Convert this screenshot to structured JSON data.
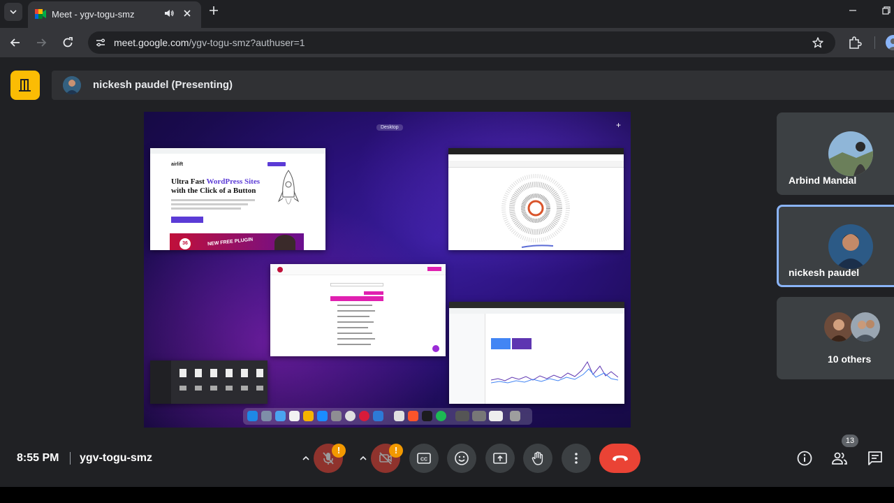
{
  "browser": {
    "tab_title": "Meet - ygv-togu-smz",
    "url_host": "meet.google.com",
    "url_path": "/ygv-togu-smz?authuser=1"
  },
  "meet": {
    "presenter_label": "nickesh paudel (Presenting)",
    "shared_screen": {
      "desktop_label": "Desktop",
      "airlift_logo": "airlift",
      "airlift_headline_1a": "Ultra Fast ",
      "airlift_headline_1b": "WordPress Sites",
      "airlift_headline_2": "with the Click of a Button",
      "airlift_banner": "NEW FREE PLUGIN",
      "airlift_badge": "36"
    },
    "participants": [
      {
        "name": "Arbind Mandal"
      },
      {
        "name": "nickesh paudel",
        "speaking": true
      },
      {
        "name": "10 others"
      }
    ],
    "bottom_bar": {
      "time": "8:55 PM",
      "meeting_code": "ygv-togu-smz",
      "people_count": "13",
      "warning_mark": "!"
    }
  },
  "colors": {
    "meet_bg": "#202124",
    "tile_bg": "#3c4043",
    "hangup_red": "#ea4335",
    "active_border": "#8ab4f8",
    "logo_yellow": "#fbbc04",
    "warning_orange": "#f29900"
  }
}
